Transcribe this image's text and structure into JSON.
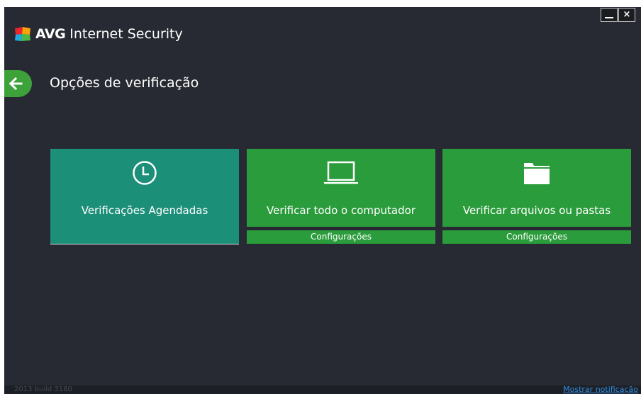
{
  "window": {
    "minimize_label": "",
    "close_label": "×"
  },
  "brand": {
    "name_bold": "AVG",
    "name_rest": "Internet Security",
    "logo_icon": "avg-logo-icon",
    "logo_colors": [
      "#e8262b",
      "#f6a20b",
      "#21a9e1",
      "#4cb847"
    ]
  },
  "header": {
    "back_icon": "arrow-left-icon",
    "title": "Opções de verificação"
  },
  "tiles": [
    {
      "icon": "clock-icon",
      "label": "Verificações Agendadas",
      "color": "#1c8f79"
    },
    {
      "icon": "laptop-icon",
      "label": "Verificar todo o computador",
      "color": "#2b9c3c",
      "settings_label": "Configurações"
    },
    {
      "icon": "folder-icon",
      "label": "Verificar arquivos ou pastas",
      "color": "#2b9c3c",
      "settings_label": "Configurações"
    }
  ],
  "footer": {
    "version": "2013  build 3180",
    "notification_link": "Mostrar notificação"
  },
  "colors": {
    "background": "#272a33",
    "accent_green": "#2b9c3c",
    "accent_teal": "#1c8f79",
    "link_blue": "#2f8de0"
  }
}
